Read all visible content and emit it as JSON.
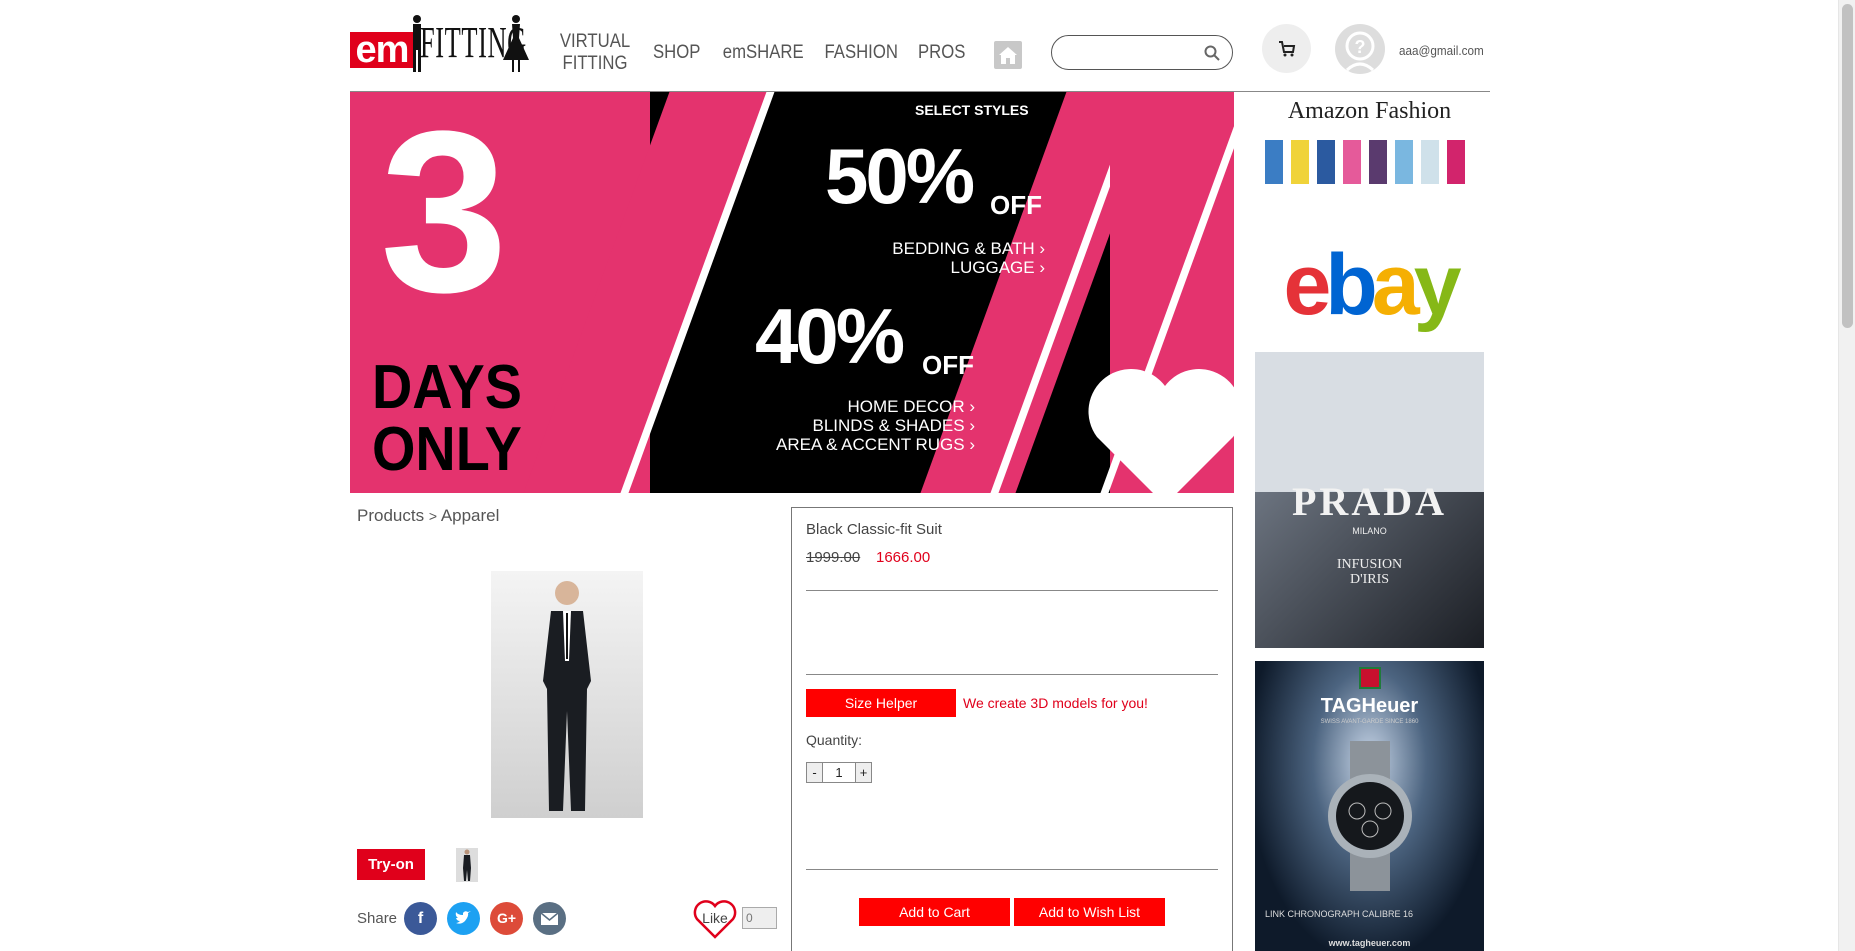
{
  "header": {
    "logo": {
      "em": "em",
      "fitting": "FITTING"
    },
    "nav": [
      {
        "label_line1": "VIRTUAL",
        "label_line2": "FITTING"
      },
      {
        "label": "SHOP"
      },
      {
        "label": "emSHARE"
      },
      {
        "label": "FASHION"
      },
      {
        "label": "PROS"
      }
    ],
    "search": {
      "value": "",
      "placeholder": ""
    },
    "user_email": "aaa@gmail.com"
  },
  "banner": {
    "big_number": "3",
    "days_line1": "DAYS",
    "days_line2": "ONLY",
    "select_styles": "SELECT STYLES",
    "offer1_pct": "50%",
    "offer1_off": "OFF",
    "offer1_items": [
      "BEDDING & BATH ›",
      "LUGGAGE ›"
    ],
    "offer2_pct": "40%",
    "offer2_off": "OFF",
    "offer2_items": [
      "HOME DECOR ›",
      "BLINDS & SHADES ›",
      "AREA & ACCENT RUGS ›"
    ]
  },
  "ads": {
    "amazon": "Amazon Fashion",
    "ebay": [
      "e",
      "b",
      "a",
      "y"
    ],
    "prada": {
      "brand": "PRADA",
      "sub": "MILANO",
      "product1": "INFUSION",
      "product2": "D'IRIS"
    },
    "tag": {
      "brand": "TAGHeuer",
      "tagline": "SWISS AVANT-GARDE SINCE 1860",
      "caption": "LINK CHRONOGRAPH CALIBRE 16",
      "url": "www.tagheuer.com"
    }
  },
  "breadcrumb": {
    "root": "Products",
    "sep": ">",
    "current": "Apparel"
  },
  "product": {
    "title": "Black Classic-fit Suit",
    "old_price": "1999.00",
    "new_price": "1666.00",
    "size_helper_label": "Size Helper",
    "size_note": "We create 3D models for you!",
    "quantity_label": "Quantity:",
    "quantity_minus": "-",
    "quantity_value": "1",
    "quantity_plus": "+",
    "add_to_cart": "Add to Cart",
    "add_to_wishlist": "Add to Wish List"
  },
  "actions": {
    "tryon_label": "Try-on",
    "share_label": "Share",
    "like_label": "Like",
    "like_count": "0"
  },
  "colors": {
    "brand_red": "#e0001b",
    "button_red": "#ff0000",
    "banner_pink": "#e4336e",
    "facebook": "#3b5998",
    "twitter": "#1da1f2",
    "google_plus": "#dd4b39",
    "email": "#5a6f83"
  }
}
